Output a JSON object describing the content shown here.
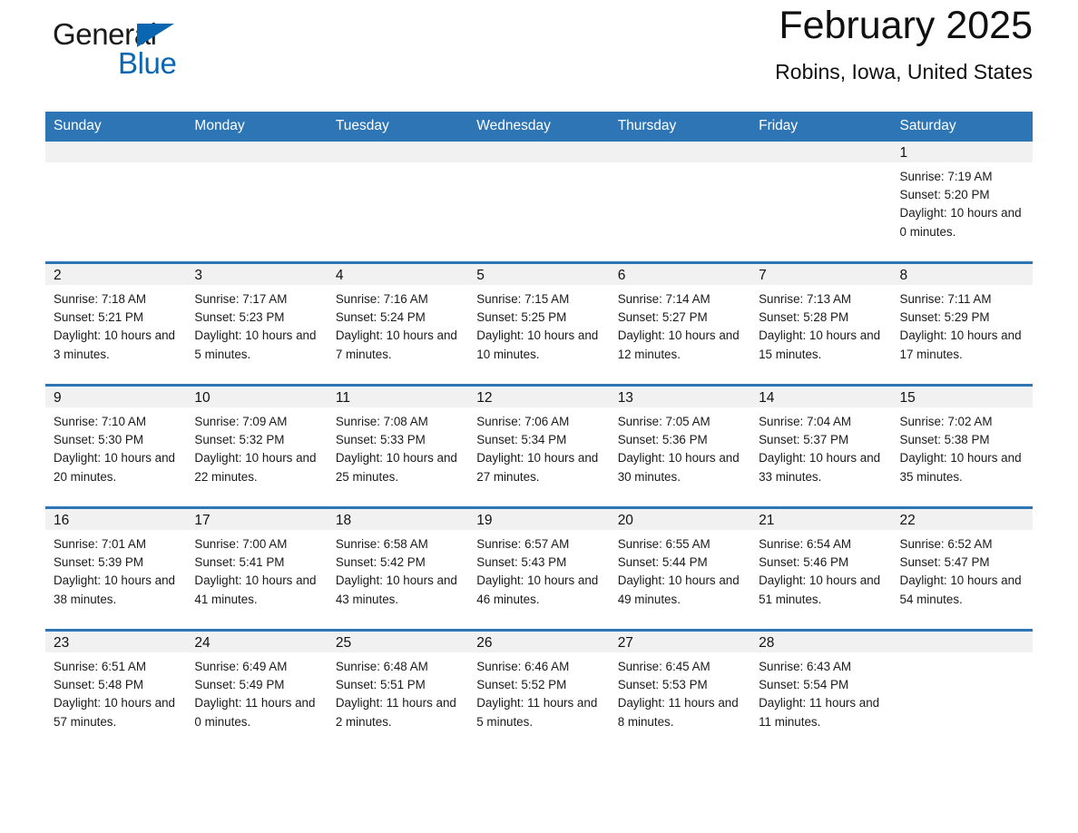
{
  "logo": {
    "word_one": "General",
    "word_two": "Blue",
    "triangle_color": "#0b66b2"
  },
  "header": {
    "title": "February 2025",
    "location": "Robins, Iowa, United States"
  },
  "theme": {
    "header_blue": "#2e75b6",
    "row_rule_blue": "#2e75b6",
    "daynum_band": "#f1f1f1",
    "text": "#1a1a1a"
  },
  "weekday_headers": [
    "Sunday",
    "Monday",
    "Tuesday",
    "Wednesday",
    "Thursday",
    "Friday",
    "Saturday"
  ],
  "labels": {
    "sunrise_prefix": "Sunrise:",
    "sunset_prefix": "Sunset:",
    "daylight_prefix": "Daylight:"
  },
  "weeks": [
    [
      {
        "empty": true
      },
      {
        "empty": true
      },
      {
        "empty": true
      },
      {
        "empty": true
      },
      {
        "empty": true
      },
      {
        "empty": true
      },
      {
        "day": "1",
        "sunrise": "Sunrise: 7:19 AM",
        "sunset": "Sunset: 5:20 PM",
        "daylight": "Daylight: 10 hours and 0 minutes."
      }
    ],
    [
      {
        "day": "2",
        "sunrise": "Sunrise: 7:18 AM",
        "sunset": "Sunset: 5:21 PM",
        "daylight": "Daylight: 10 hours and 3 minutes."
      },
      {
        "day": "3",
        "sunrise": "Sunrise: 7:17 AM",
        "sunset": "Sunset: 5:23 PM",
        "daylight": "Daylight: 10 hours and 5 minutes."
      },
      {
        "day": "4",
        "sunrise": "Sunrise: 7:16 AM",
        "sunset": "Sunset: 5:24 PM",
        "daylight": "Daylight: 10 hours and 7 minutes."
      },
      {
        "day": "5",
        "sunrise": "Sunrise: 7:15 AM",
        "sunset": "Sunset: 5:25 PM",
        "daylight": "Daylight: 10 hours and 10 minutes."
      },
      {
        "day": "6",
        "sunrise": "Sunrise: 7:14 AM",
        "sunset": "Sunset: 5:27 PM",
        "daylight": "Daylight: 10 hours and 12 minutes."
      },
      {
        "day": "7",
        "sunrise": "Sunrise: 7:13 AM",
        "sunset": "Sunset: 5:28 PM",
        "daylight": "Daylight: 10 hours and 15 minutes."
      },
      {
        "day": "8",
        "sunrise": "Sunrise: 7:11 AM",
        "sunset": "Sunset: 5:29 PM",
        "daylight": "Daylight: 10 hours and 17 minutes."
      }
    ],
    [
      {
        "day": "9",
        "sunrise": "Sunrise: 7:10 AM",
        "sunset": "Sunset: 5:30 PM",
        "daylight": "Daylight: 10 hours and 20 minutes."
      },
      {
        "day": "10",
        "sunrise": "Sunrise: 7:09 AM",
        "sunset": "Sunset: 5:32 PM",
        "daylight": "Daylight: 10 hours and 22 minutes."
      },
      {
        "day": "11",
        "sunrise": "Sunrise: 7:08 AM",
        "sunset": "Sunset: 5:33 PM",
        "daylight": "Daylight: 10 hours and 25 minutes."
      },
      {
        "day": "12",
        "sunrise": "Sunrise: 7:06 AM",
        "sunset": "Sunset: 5:34 PM",
        "daylight": "Daylight: 10 hours and 27 minutes."
      },
      {
        "day": "13",
        "sunrise": "Sunrise: 7:05 AM",
        "sunset": "Sunset: 5:36 PM",
        "daylight": "Daylight: 10 hours and 30 minutes."
      },
      {
        "day": "14",
        "sunrise": "Sunrise: 7:04 AM",
        "sunset": "Sunset: 5:37 PM",
        "daylight": "Daylight: 10 hours and 33 minutes."
      },
      {
        "day": "15",
        "sunrise": "Sunrise: 7:02 AM",
        "sunset": "Sunset: 5:38 PM",
        "daylight": "Daylight: 10 hours and 35 minutes."
      }
    ],
    [
      {
        "day": "16",
        "sunrise": "Sunrise: 7:01 AM",
        "sunset": "Sunset: 5:39 PM",
        "daylight": "Daylight: 10 hours and 38 minutes."
      },
      {
        "day": "17",
        "sunrise": "Sunrise: 7:00 AM",
        "sunset": "Sunset: 5:41 PM",
        "daylight": "Daylight: 10 hours and 41 minutes."
      },
      {
        "day": "18",
        "sunrise": "Sunrise: 6:58 AM",
        "sunset": "Sunset: 5:42 PM",
        "daylight": "Daylight: 10 hours and 43 minutes."
      },
      {
        "day": "19",
        "sunrise": "Sunrise: 6:57 AM",
        "sunset": "Sunset: 5:43 PM",
        "daylight": "Daylight: 10 hours and 46 minutes."
      },
      {
        "day": "20",
        "sunrise": "Sunrise: 6:55 AM",
        "sunset": "Sunset: 5:44 PM",
        "daylight": "Daylight: 10 hours and 49 minutes."
      },
      {
        "day": "21",
        "sunrise": "Sunrise: 6:54 AM",
        "sunset": "Sunset: 5:46 PM",
        "daylight": "Daylight: 10 hours and 51 minutes."
      },
      {
        "day": "22",
        "sunrise": "Sunrise: 6:52 AM",
        "sunset": "Sunset: 5:47 PM",
        "daylight": "Daylight: 10 hours and 54 minutes."
      }
    ],
    [
      {
        "day": "23",
        "sunrise": "Sunrise: 6:51 AM",
        "sunset": "Sunset: 5:48 PM",
        "daylight": "Daylight: 10 hours and 57 minutes."
      },
      {
        "day": "24",
        "sunrise": "Sunrise: 6:49 AM",
        "sunset": "Sunset: 5:49 PM",
        "daylight": "Daylight: 11 hours and 0 minutes."
      },
      {
        "day": "25",
        "sunrise": "Sunrise: 6:48 AM",
        "sunset": "Sunset: 5:51 PM",
        "daylight": "Daylight: 11 hours and 2 minutes."
      },
      {
        "day": "26",
        "sunrise": "Sunrise: 6:46 AM",
        "sunset": "Sunset: 5:52 PM",
        "daylight": "Daylight: 11 hours and 5 minutes."
      },
      {
        "day": "27",
        "sunrise": "Sunrise: 6:45 AM",
        "sunset": "Sunset: 5:53 PM",
        "daylight": "Daylight: 11 hours and 8 minutes."
      },
      {
        "day": "28",
        "sunrise": "Sunrise: 6:43 AM",
        "sunset": "Sunset: 5:54 PM",
        "daylight": "Daylight: 11 hours and 11 minutes."
      },
      {
        "empty": true
      }
    ]
  ]
}
